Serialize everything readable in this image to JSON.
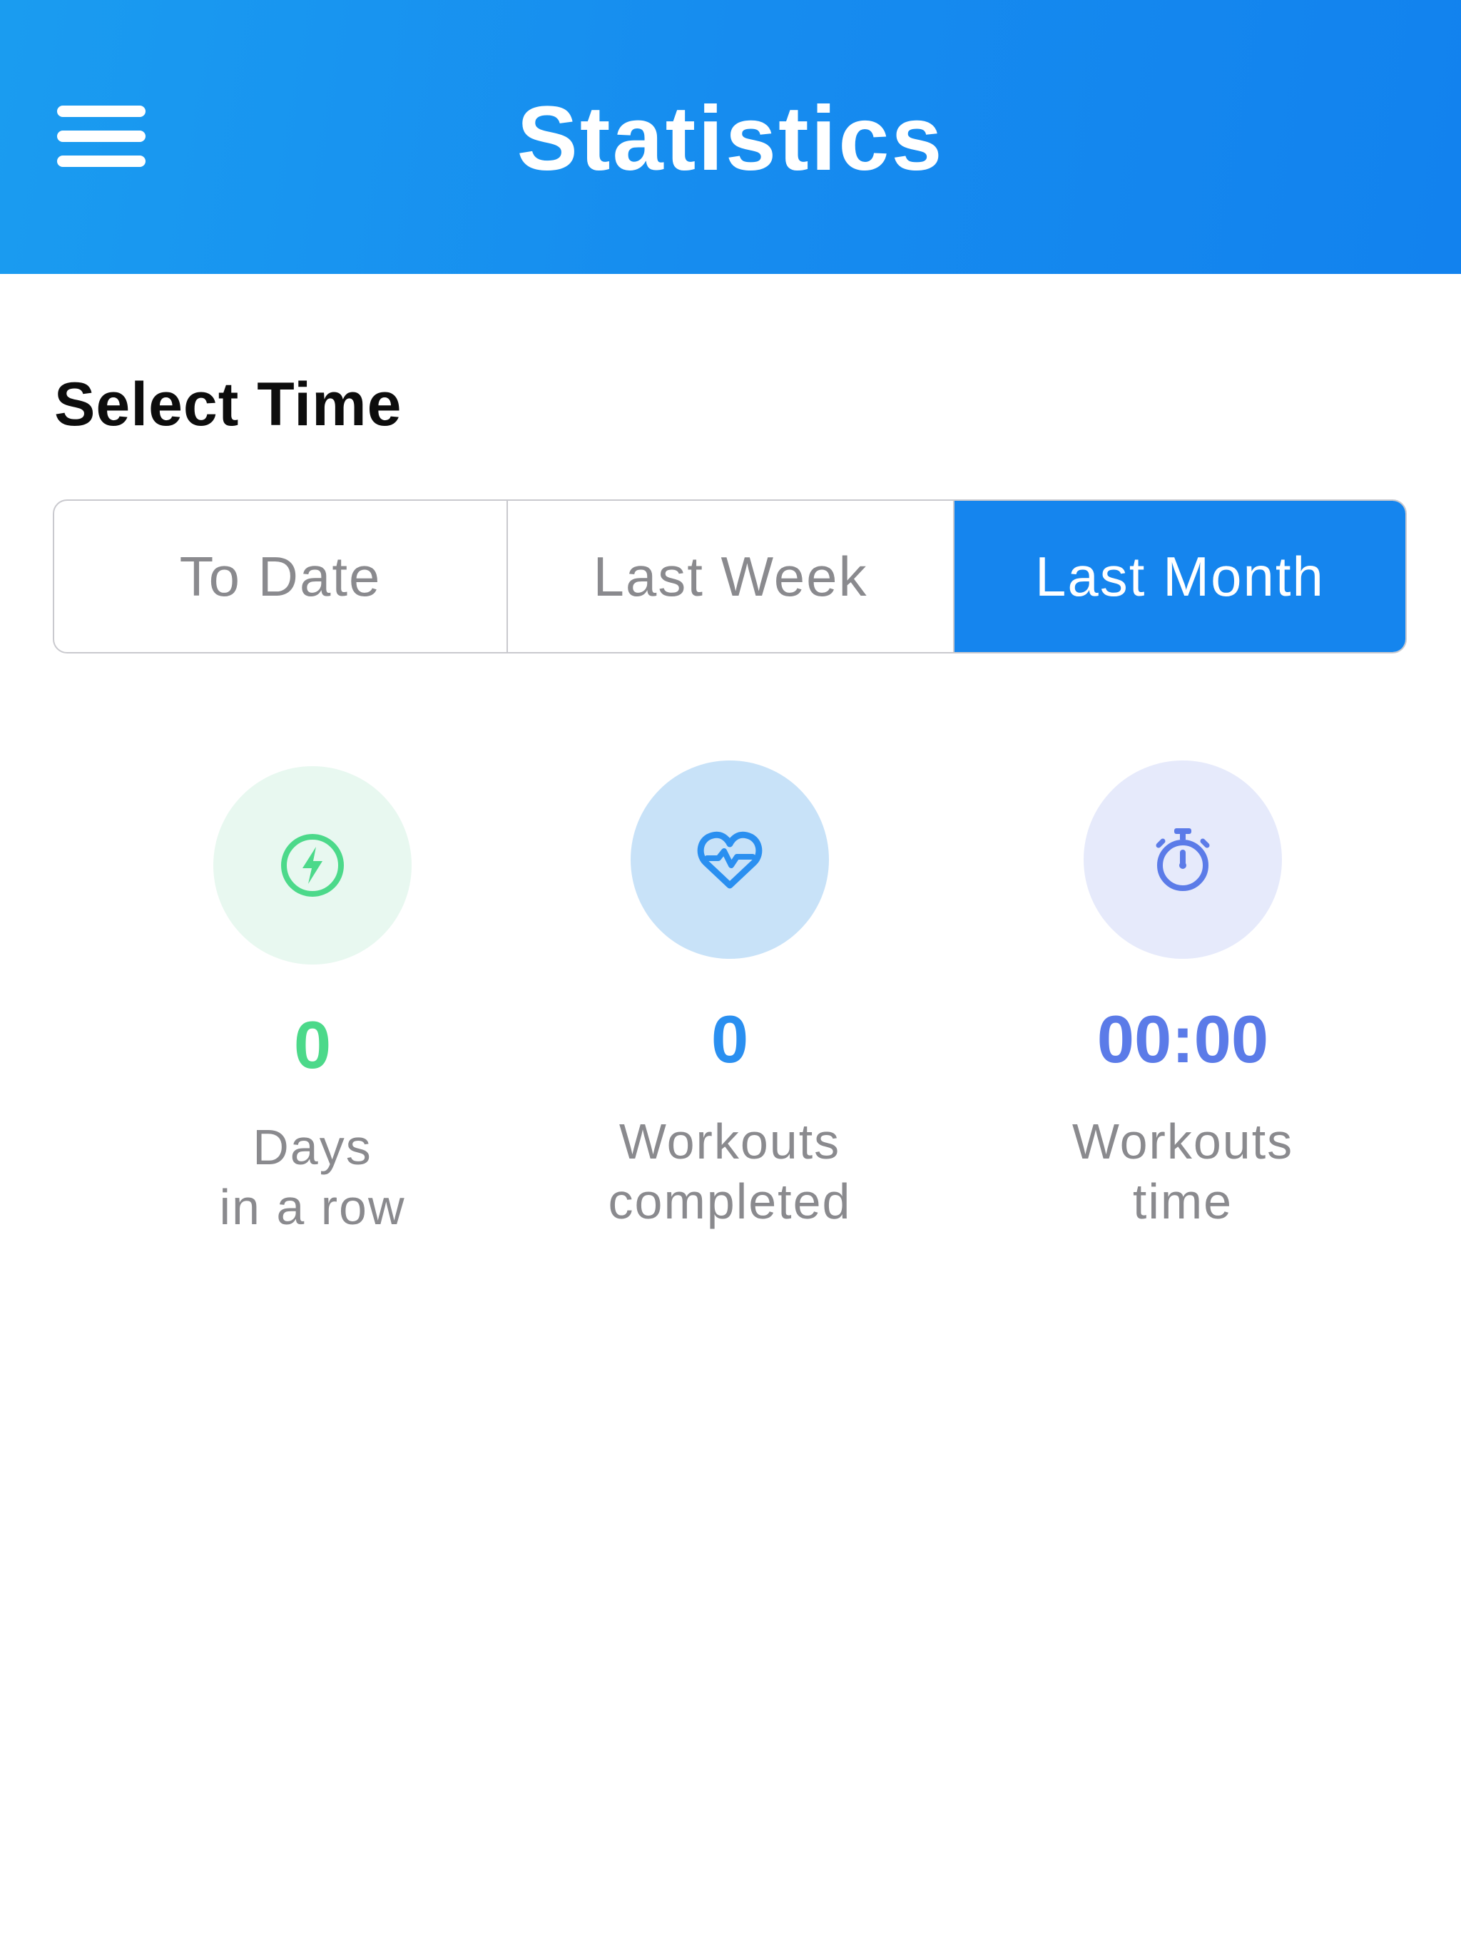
{
  "header": {
    "title": "Statistics",
    "menu_icon": "hamburger-menu-icon",
    "background": "#168cef"
  },
  "section": {
    "title": "Select Time"
  },
  "segments": [
    {
      "label": "To Date",
      "selected": false
    },
    {
      "label": "Last Week",
      "selected": false
    },
    {
      "label": "Last Month",
      "selected": true
    }
  ],
  "stats": [
    {
      "icon": "lightning-bolt-icon",
      "value": "0",
      "label_line1": "Days",
      "label_line2": "in a row",
      "color": "#4cd98a",
      "bg": "#e8f8f0"
    },
    {
      "icon": "heart-pulse-icon",
      "value": "0",
      "label_line1": "Workouts",
      "label_line2": "completed",
      "color": "#2a8ff0",
      "bg": "#c8e2f8"
    },
    {
      "icon": "stopwatch-icon",
      "value": "00:00",
      "label_line1": "Workouts",
      "label_line2": "time",
      "color": "#5b7be8",
      "bg": "#e6eafb"
    }
  ]
}
